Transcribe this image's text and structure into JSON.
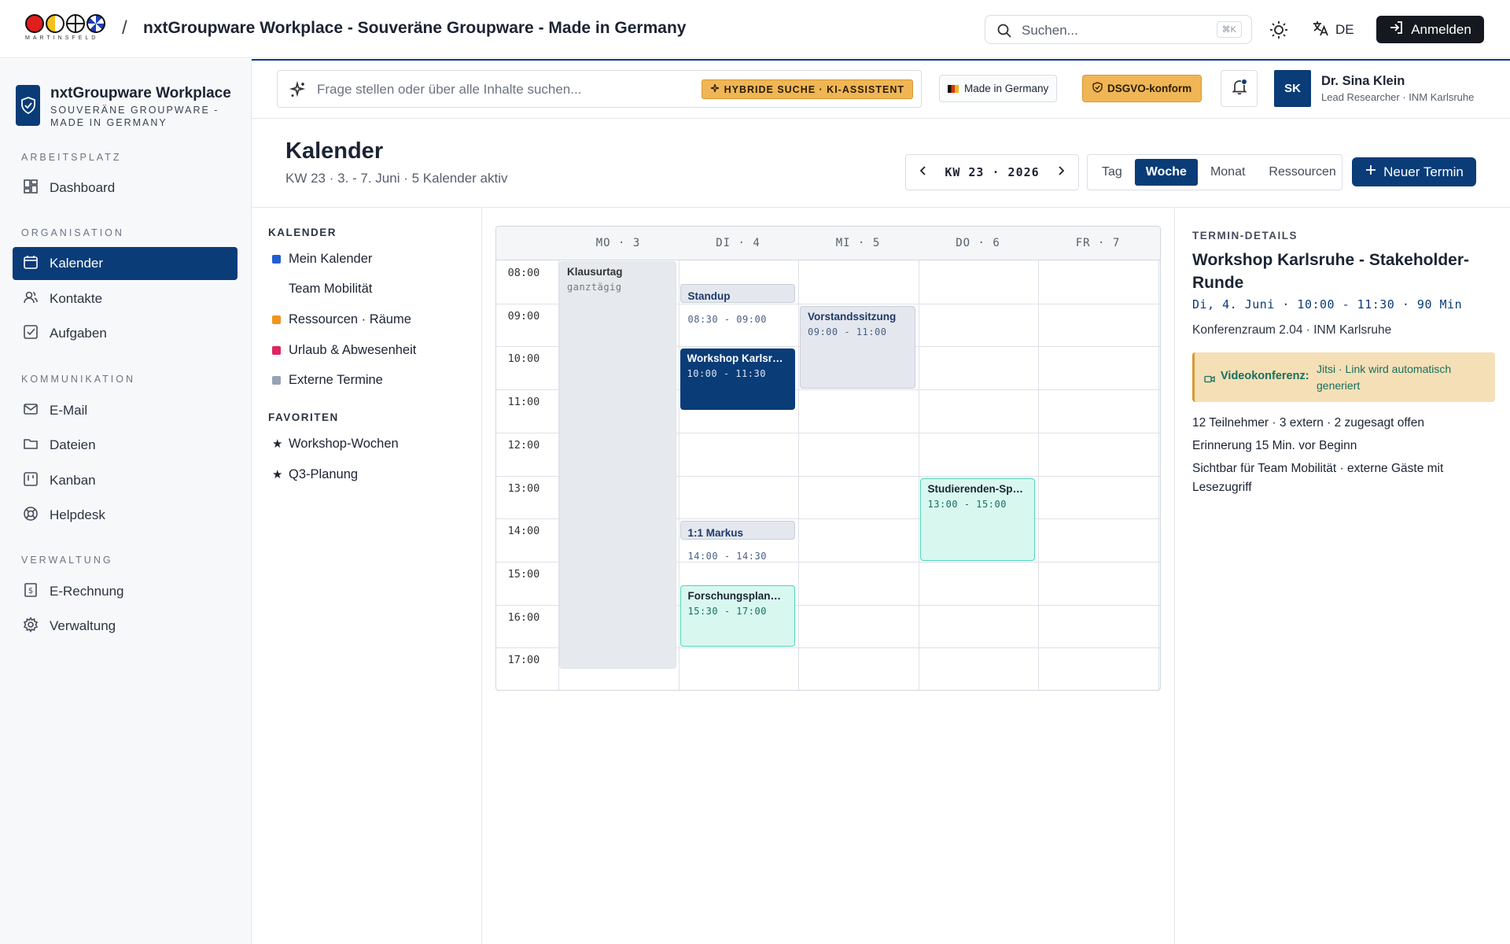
{
  "topbar": {
    "logo_text": "MARTINSFELD",
    "title": "nxtGroupware Workplace - Souveräne Groupware - Made in Germany",
    "search_placeholder": "Suchen...",
    "search_shortcut": "⌘K",
    "language": "DE",
    "login_label": "Anmelden",
    "icons": {
      "search": "search-icon",
      "theme": "sun-icon",
      "language": "translate-icon",
      "login": "login-icon"
    }
  },
  "sidebar": {
    "brand_title": "nxtGroupware Workplace",
    "brand_subtitle": "SOUVERÄNE GROUPWARE - MADE IN GERMANY",
    "sections": [
      {
        "label": "ARBEITSPLATZ",
        "items": [
          {
            "label": "Dashboard",
            "icon": "dashboard-icon"
          }
        ]
      },
      {
        "label": "ORGANISATION",
        "items": [
          {
            "label": "Kalender",
            "icon": "calendar-icon",
            "active": true
          },
          {
            "label": "Kontakte",
            "icon": "contacts-icon"
          },
          {
            "label": "Aufgaben",
            "icon": "tasks-icon"
          }
        ]
      },
      {
        "label": "KOMMUNIKATION",
        "items": [
          {
            "label": "E-Mail",
            "icon": "mail-icon"
          },
          {
            "label": "Dateien",
            "icon": "folder-icon"
          },
          {
            "label": "Kanban",
            "icon": "kanban-icon"
          },
          {
            "label": "Helpdesk",
            "icon": "lifebuoy-icon"
          }
        ]
      },
      {
        "label": "VERWALTUNG",
        "items": [
          {
            "label": "E-Rechnung",
            "icon": "invoice-icon"
          },
          {
            "label": "Verwaltung",
            "icon": "gear-icon"
          }
        ]
      }
    ]
  },
  "header": {
    "ask_placeholder": "Frage stellen oder über alle Inhalte suchen...",
    "ask_badge": "HYBRIDE SUCHE · KI-ASSISTENT",
    "made_in_germany": "Made in Germany",
    "dsgvo": "DSGVO-konform",
    "user_initials": "SK",
    "user_name": "Dr. Sina Klein",
    "user_role": "Lead Researcher · INM Karlsruhe"
  },
  "page": {
    "title": "Kalender",
    "subtitle": "KW 23 · 3. - 7. Juni · 5 Kalender aktiv",
    "week_label": "KW 23 · 2026",
    "views": [
      "Tag",
      "Woche",
      "Monat",
      "Ressourcen"
    ],
    "active_view": "Woche",
    "new_button": "Neuer Termin"
  },
  "calendars": {
    "label": "KALENDER",
    "items": [
      {
        "label": "Mein Kalender",
        "color": "#1f5fd1"
      },
      {
        "label": "Team Mobilität",
        "color": ""
      },
      {
        "label": "Ressourcen · Räume",
        "color": "#f0961e"
      },
      {
        "label": "Urlaub & Abwesenheit",
        "color": "#e0245e"
      },
      {
        "label": "Externe Termine",
        "color": "#96a3b5"
      }
    ],
    "favorites_label": "FAVORITEN",
    "favorites": [
      "Workshop-Wochen",
      "Q3-Planung"
    ]
  },
  "grid": {
    "days": [
      "MO · 3",
      "DI · 4",
      "MI · 5",
      "DO · 6",
      "FR · 7"
    ],
    "hours": [
      "08:00",
      "09:00",
      "10:00",
      "11:00",
      "12:00",
      "13:00",
      "14:00",
      "15:00",
      "16:00",
      "17:00"
    ],
    "events": [
      {
        "title": "Klausurtag",
        "time": "ganztägig",
        "day": 0,
        "start": 8.0,
        "end": 17.5,
        "style": "allday"
      },
      {
        "title": "Standup",
        "time": "08:30 - 09:00",
        "day": 1,
        "start": 8.5,
        "end": 9.0,
        "style": "gray"
      },
      {
        "title": "Workshop Karlsruhe - Stakeholder-Runde",
        "time": "10:00 - 11:30",
        "day": 1,
        "start": 10.0,
        "end": 11.5,
        "style": "blue"
      },
      {
        "title": "1:1 Markus",
        "time": "14:00 - 14:30",
        "day": 1,
        "start": 14.0,
        "end": 14.5,
        "style": "gray"
      },
      {
        "title": "Forschungsplanung",
        "time": "15:30 - 17:00",
        "day": 1,
        "start": 15.5,
        "end": 17.0,
        "style": "mint"
      },
      {
        "title": "Vorstandssitzung",
        "time": "09:00 - 11:00",
        "day": 2,
        "start": 9.0,
        "end": 11.0,
        "style": "gray"
      },
      {
        "title": "Studierenden-Sprechstunde",
        "time": "13:00 - 15:00",
        "day": 3,
        "start": 13.0,
        "end": 15.0,
        "style": "mint"
      }
    ]
  },
  "details": {
    "label": "TERMIN-DETAILS",
    "title": "Workshop Karlsruhe - Stakeholder-Runde",
    "when": "Di, 4. Juni · 10:00 - 11:30 · 90 Min",
    "location": "Konferenzraum 2.04 · INM Karlsruhe",
    "video_label": "Videokonferenz:",
    "video_value": "Jitsi · Link wird automatisch generiert",
    "participants": "12 Teilnehmer · 3 extern · 2 zugesagt offen",
    "reminder": "Erinnerung 15 Min. vor Beginn",
    "visibility": "Sichtbar für Team Mobilität · externe Gäste mit Lesezugriff"
  }
}
